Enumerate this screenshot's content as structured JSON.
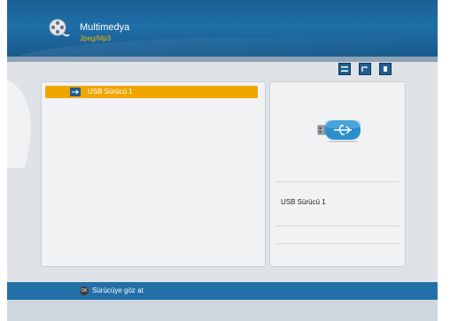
{
  "header": {
    "title": "Multimedya",
    "subtitle": "Jpeg/Mp3",
    "icon": "film-reel-icon"
  },
  "toolbar": {
    "buttons": [
      {
        "icon": "grid-view-icon"
      },
      {
        "icon": "return-icon"
      },
      {
        "icon": "info-icon"
      }
    ]
  },
  "list": {
    "items": [
      {
        "label": "USB Sürücü 1",
        "selected": true,
        "icon": "usb-icon"
      }
    ]
  },
  "details": {
    "icon": "usb-drive-icon",
    "name": "USB Sürücü 1"
  },
  "footer": {
    "ok_label": "OK",
    "hint": "Sürücüye göz at"
  },
  "colors": {
    "header": "#1f6ea8",
    "selection": "#f0a600",
    "subtitle": "#f2b400",
    "background": "#dfe2e6"
  }
}
